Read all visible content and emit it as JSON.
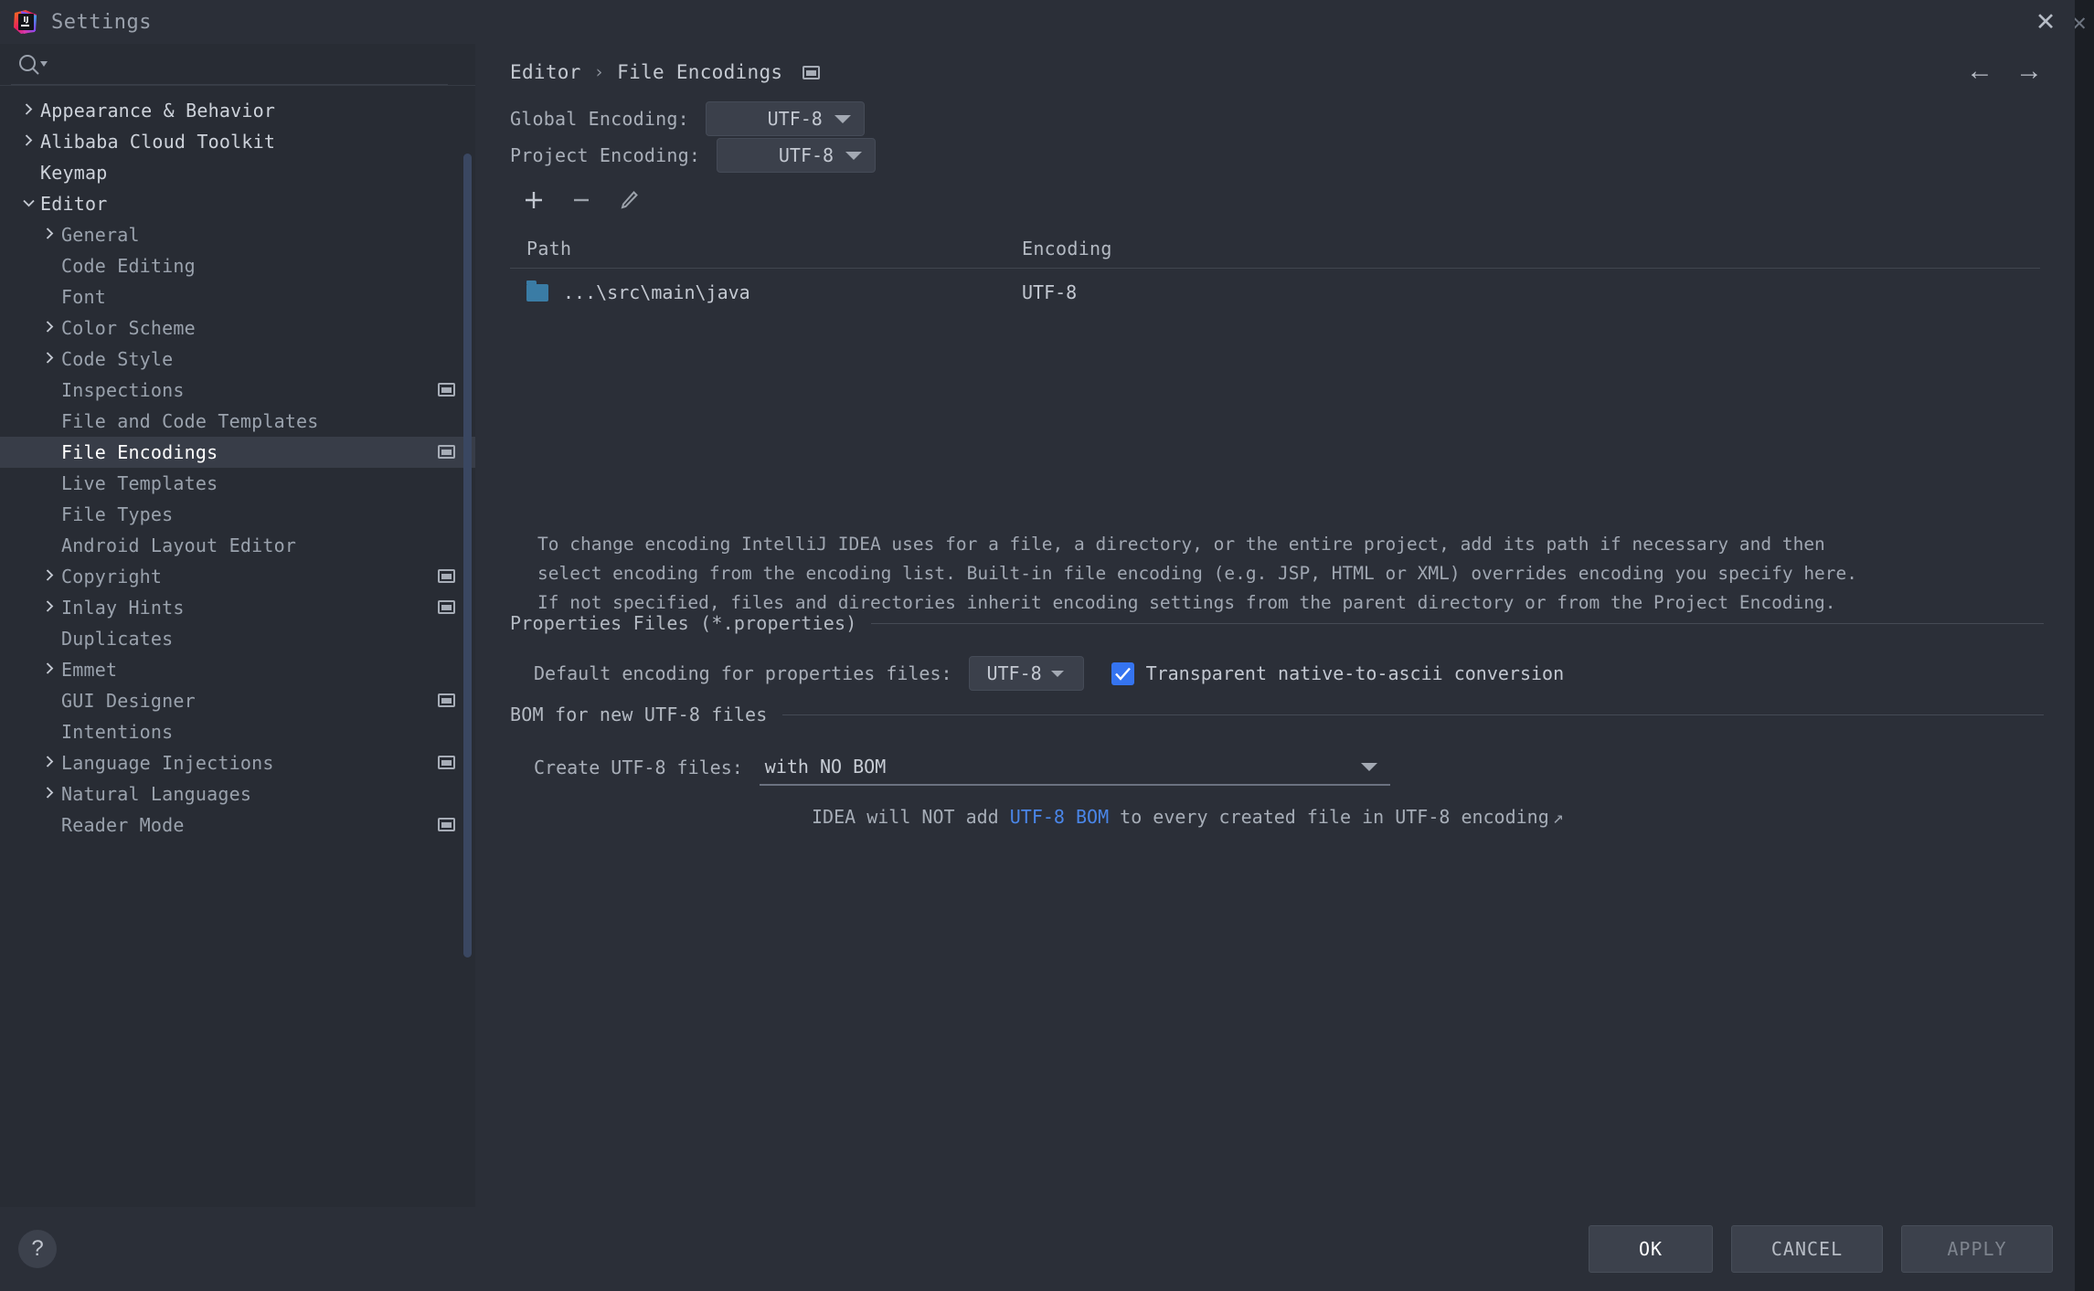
{
  "window": {
    "title": "Settings",
    "logo_icon": "intellij-idea-logo",
    "close_icon": "close-icon"
  },
  "search": {
    "icon": "search-icon",
    "placeholder": "",
    "value": ""
  },
  "sidebar": {
    "items": [
      {
        "label": "Appearance & Behavior",
        "level": 0,
        "chevron": "chevron-right",
        "badge": false,
        "selected": false
      },
      {
        "label": "Alibaba Cloud Toolkit",
        "level": 0,
        "chevron": "chevron-right",
        "badge": false,
        "selected": false
      },
      {
        "label": "Keymap",
        "level": 0,
        "chevron": "none",
        "badge": false,
        "selected": false
      },
      {
        "label": "Editor",
        "level": 0,
        "chevron": "chevron-down",
        "badge": false,
        "selected": false
      },
      {
        "label": "General",
        "level": 1,
        "chevron": "chevron-right",
        "badge": false,
        "selected": false
      },
      {
        "label": "Code Editing",
        "level": 1,
        "chevron": "none",
        "badge": false,
        "selected": false
      },
      {
        "label": "Font",
        "level": 1,
        "chevron": "none",
        "badge": false,
        "selected": false
      },
      {
        "label": "Color Scheme",
        "level": 1,
        "chevron": "chevron-right",
        "badge": false,
        "selected": false
      },
      {
        "label": "Code Style",
        "level": 1,
        "chevron": "chevron-right",
        "badge": false,
        "selected": false
      },
      {
        "label": "Inspections",
        "level": 1,
        "chevron": "none",
        "badge": true,
        "selected": false
      },
      {
        "label": "File and Code Templates",
        "level": 1,
        "chevron": "none",
        "badge": false,
        "selected": false
      },
      {
        "label": "File Encodings",
        "level": 1,
        "chevron": "none",
        "badge": true,
        "selected": true
      },
      {
        "label": "Live Templates",
        "level": 1,
        "chevron": "none",
        "badge": false,
        "selected": false
      },
      {
        "label": "File Types",
        "level": 1,
        "chevron": "none",
        "badge": false,
        "selected": false
      },
      {
        "label": "Android Layout Editor",
        "level": 1,
        "chevron": "none",
        "badge": false,
        "selected": false
      },
      {
        "label": "Copyright",
        "level": 1,
        "chevron": "chevron-right",
        "badge": true,
        "selected": false
      },
      {
        "label": "Inlay Hints",
        "level": 1,
        "chevron": "chevron-right",
        "badge": true,
        "selected": false
      },
      {
        "label": "Duplicates",
        "level": 1,
        "chevron": "none",
        "badge": false,
        "selected": false
      },
      {
        "label": "Emmet",
        "level": 1,
        "chevron": "chevron-right",
        "badge": false,
        "selected": false
      },
      {
        "label": "GUI Designer",
        "level": 1,
        "chevron": "none",
        "badge": true,
        "selected": false
      },
      {
        "label": "Intentions",
        "level": 1,
        "chevron": "none",
        "badge": false,
        "selected": false
      },
      {
        "label": "Language Injections",
        "level": 1,
        "chevron": "chevron-right",
        "badge": true,
        "selected": false
      },
      {
        "label": "Natural Languages",
        "level": 1,
        "chevron": "chevron-right",
        "badge": false,
        "selected": false
      },
      {
        "label": "Reader Mode",
        "level": 1,
        "chevron": "none",
        "badge": true,
        "selected": false
      }
    ]
  },
  "breadcrumb": {
    "parent": "Editor",
    "separator": "›",
    "current": "File Encodings",
    "badge_icon": "project-level-settings-icon",
    "back_icon": "←",
    "forward_icon": "→"
  },
  "main": {
    "global_encoding": {
      "label": "Global Encoding:",
      "value": "UTF-8"
    },
    "project_encoding": {
      "label": "Project Encoding:",
      "value": "UTF-8"
    },
    "toolbar": {
      "add_icon": "plus-icon",
      "remove_icon": "minus-icon",
      "edit_icon": "pencil-icon"
    },
    "table": {
      "columns": [
        "Path",
        "Encoding"
      ],
      "rows": [
        {
          "icon": "folder-icon",
          "path": "...\\src\\main\\java",
          "encoding": "UTF-8"
        }
      ]
    },
    "hint_lines": [
      "To change encoding IntelliJ IDEA uses for a file, a directory, or the entire project, add its path if necessary and then",
      "select encoding from the encoding list. Built-in file encoding (e.g. JSP, HTML or XML) overrides encoding you specify here.",
      "If not specified, files and directories inherit encoding settings from the parent directory or from the Project Encoding."
    ],
    "properties_section": {
      "title": "Properties Files (*.properties)",
      "default_encoding_label": "Default encoding for properties files:",
      "default_encoding_value": "UTF-8",
      "transparent_label": "Transparent native-to-ascii conversion",
      "transparent_checked": true
    },
    "bom_section": {
      "title": "BOM for new UTF-8 files",
      "create_label": "Create UTF-8 files:",
      "create_value": "with NO BOM",
      "hint_prefix": "IDEA will NOT add ",
      "hint_link": "UTF-8 BOM",
      "hint_suffix": " to every created file in UTF-8 encoding",
      "hint_external_icon": "↗"
    }
  },
  "footer": {
    "help_label": "?",
    "ok_label": "OK",
    "cancel_label": "CANCEL",
    "apply_label": "APPLY"
  },
  "colors": {
    "dialog_bg": "#2b2f38",
    "sidebar_bg": "#282c34",
    "selection_bg": "#383d48",
    "accent_blue": "#3574f0",
    "link_blue": "#4a86e8",
    "folder_blue": "#3a7ca5",
    "scrollbar": "#3a4761"
  }
}
